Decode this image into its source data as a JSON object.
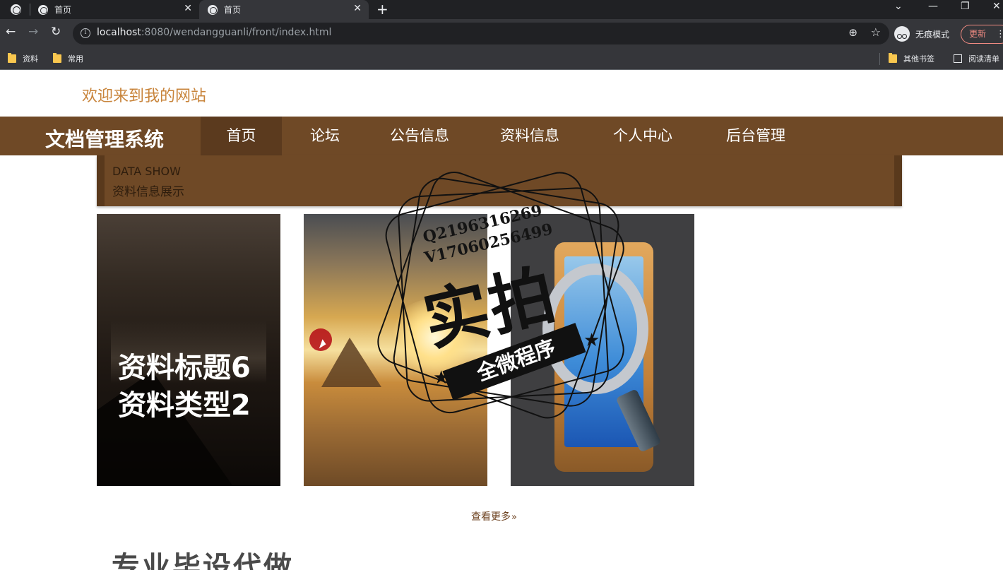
{
  "browser": {
    "tabs": [
      {
        "title": "首页"
      },
      {
        "title": "首页"
      }
    ],
    "url_host": "localhost",
    "url_path": ":8080/wendangguanli/front/index.html",
    "incognito_label": "无痕模式",
    "update_label": "更新",
    "bookmarks": [
      {
        "label": "资料"
      },
      {
        "label": "常用"
      },
      {
        "label": "其他书签"
      },
      {
        "label": "阅读清单"
      }
    ]
  },
  "page": {
    "welcome": "欢迎来到我的网站",
    "site_title": "文档管理系统",
    "nav": [
      {
        "label": "首页",
        "active": true
      },
      {
        "label": "论坛"
      },
      {
        "label": "公告信息"
      },
      {
        "label": "资料信息"
      },
      {
        "label": "个人中心"
      },
      {
        "label": "后台管理"
      }
    ],
    "section_en": "DATA SHOW",
    "section_cn": "资料信息展示",
    "cards": [
      {
        "title": "资料标题6",
        "type": "资料类型2"
      },
      {
        "title": "",
        "type": ""
      },
      {
        "title": "",
        "type": ""
      }
    ],
    "more_link": "查看更多",
    "bottom_banner": "专业毕设代做"
  },
  "watermark": {
    "qq": "Q2196316269",
    "wechat": "V17060256499",
    "big": "实拍",
    "small": "全微程序"
  },
  "colors": {
    "brand_brown": "#6f4926",
    "welcome_orange": "#c8843b",
    "more_link_brown": "#6b3f1c"
  }
}
